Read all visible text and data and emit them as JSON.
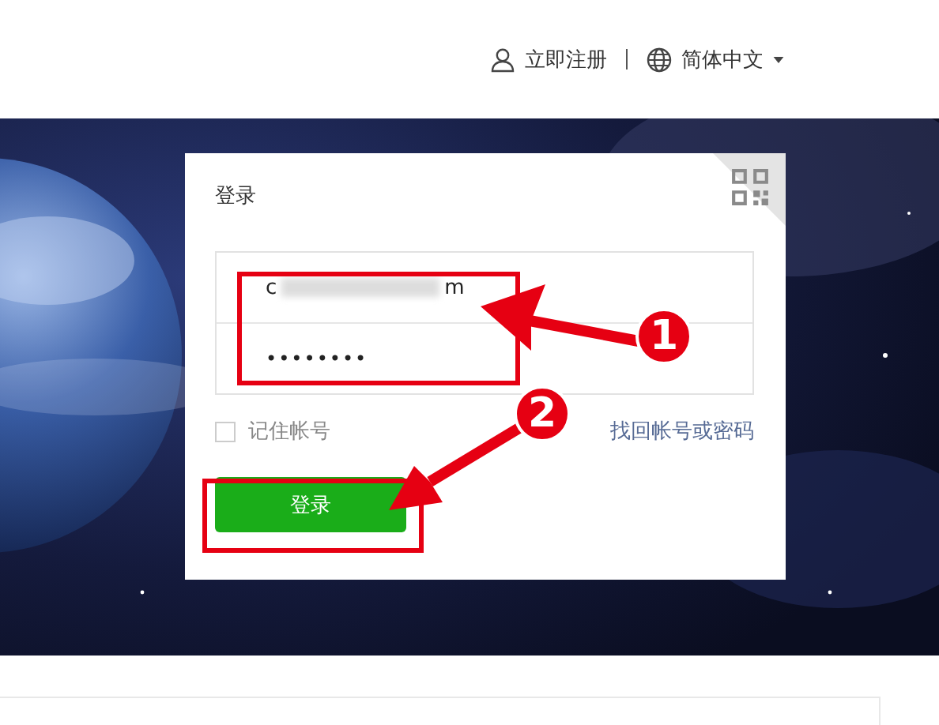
{
  "header": {
    "register": "立即注册",
    "language": "简体中文"
  },
  "login": {
    "title": "登录",
    "account": {
      "value_start": "c",
      "value_end": "m",
      "blurred": true
    },
    "password": {
      "value": "••••••••"
    },
    "remember": {
      "label": "记住帐号",
      "checked": false
    },
    "forgot_link": "找回帐号或密码",
    "submit": "登录"
  },
  "annotations": [
    {
      "label": "1"
    },
    {
      "label": "2"
    }
  ]
}
